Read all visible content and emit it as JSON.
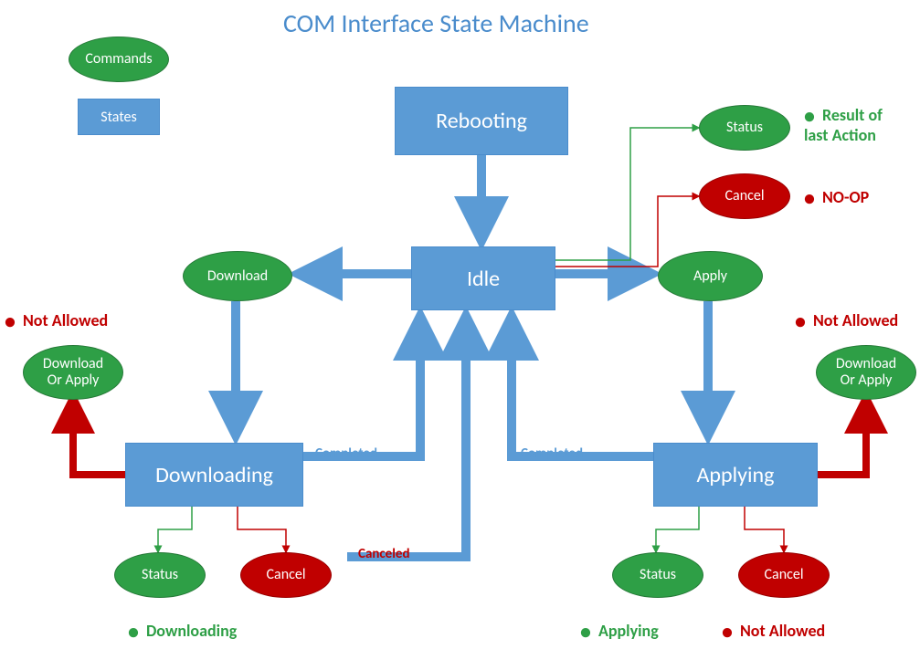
{
  "title": "COM Interface State Machine",
  "legend": {
    "commands": "Commands",
    "states": "States"
  },
  "states": {
    "rebooting": "Rebooting",
    "idle": "Idle",
    "downloading": "Downloading",
    "applying": "Applying"
  },
  "commands": {
    "download": "Download",
    "apply": "Apply",
    "status": "Status",
    "cancel": "Cancel",
    "download_or_apply": "Download\nOr Apply"
  },
  "labels": {
    "completed": "Completed",
    "canceled": "Canceled"
  },
  "bullets": {
    "result_of_last_action": "Result of\nlast Action",
    "noop": "NO-OP",
    "not_allowed": "Not Allowed",
    "downloading": "Downloading",
    "applying": "Applying"
  }
}
